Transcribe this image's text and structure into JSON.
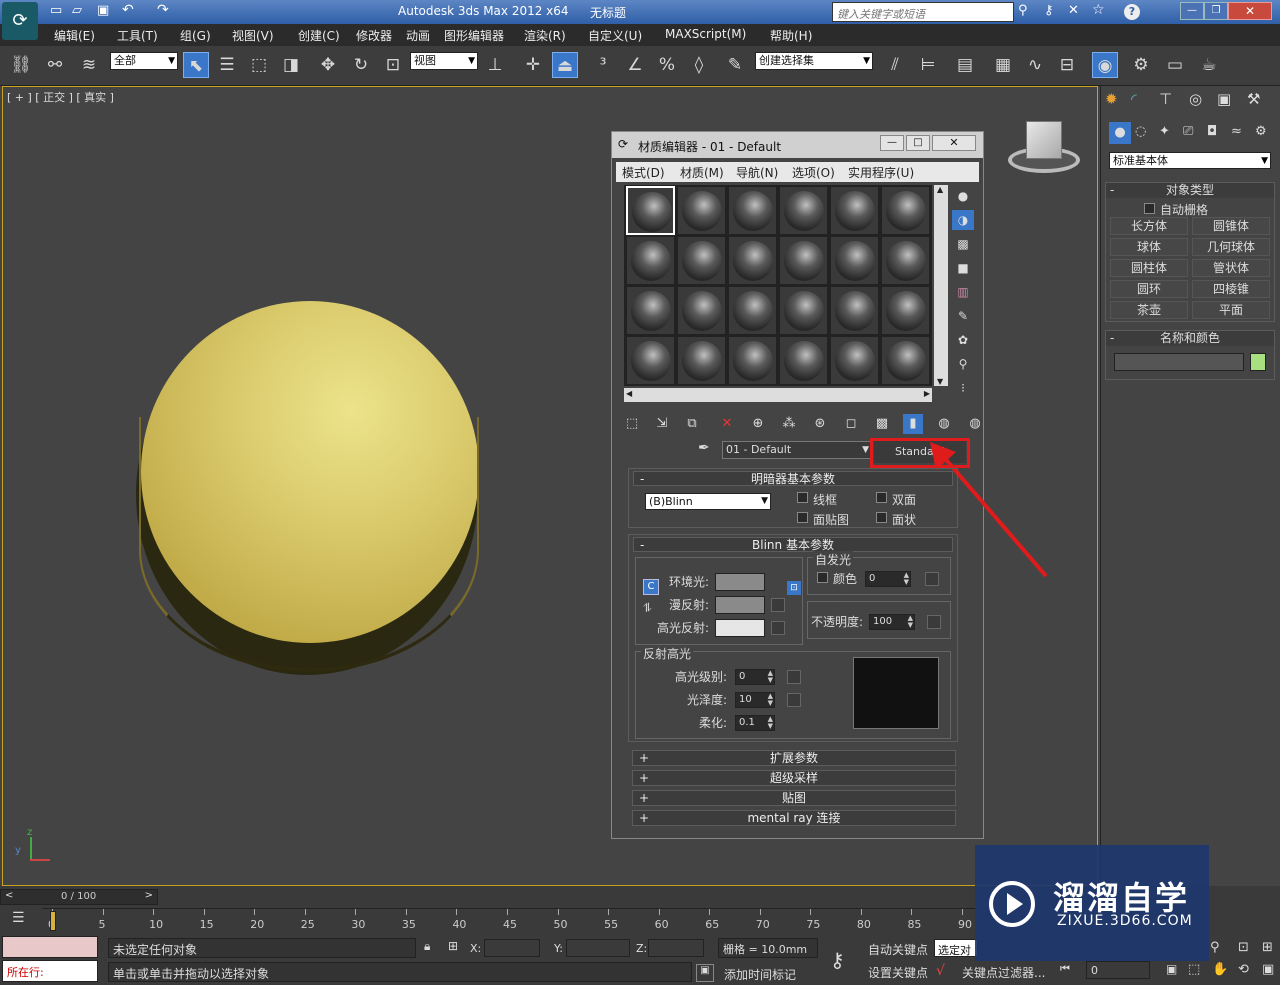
{
  "title_bar": {
    "app_title": "Autodesk 3ds Max  2012 x64",
    "doc_title": "无标题",
    "search_placeholder": "键入关键字或短语",
    "help": "?"
  },
  "menu": [
    "编辑(E)",
    "工具(T)",
    "组(G)",
    "视图(V)",
    "创建(C)",
    "修改器",
    "动画",
    "图形编辑器",
    "渲染(R)",
    "自定义(U)",
    "MAXScript(M)",
    "帮助(H)"
  ],
  "toolbar": {
    "selection_filter": "全部",
    "ref_coord": "视图",
    "named_selection": "创建选择集"
  },
  "viewport": {
    "label": "[ + ] [ 正交 ] [ 真实 ]"
  },
  "material_editor": {
    "title": "材质编辑器 - 01 - Default",
    "menus": [
      "模式(D)",
      "材质(M)",
      "导航(N)",
      "选项(O)",
      "实用程序(U)"
    ],
    "material_name": "01 - Default",
    "material_type": "Standard",
    "shader_rollout": {
      "title": "明暗器基本参数",
      "shader": "(B)Blinn",
      "wire": "线框",
      "two_sided": "双面",
      "face_map": "面贴图",
      "faceted": "面状"
    },
    "blinn_rollout": {
      "title": "Blinn 基本参数",
      "self_illum": "自发光",
      "color_label": "颜色",
      "color_value": "0",
      "ambient": "环境光:",
      "diffuse": "漫反射:",
      "specular": "高光反射:",
      "opacity_label": "不透明度:",
      "opacity_value": "100",
      "lock": "C"
    },
    "specular_highlights": {
      "title": "反射高光",
      "level_label": "高光级别:",
      "level_value": "0",
      "gloss_label": "光泽度:",
      "gloss_value": "10",
      "soften_label": "柔化:",
      "soften_value": "0.1"
    },
    "collapsed_rollouts": [
      "扩展参数",
      "超级采样",
      "贴图",
      "mental ray 连接"
    ],
    "colors": {
      "ambient": "#8a8a8a",
      "diffuse": "#8a8a8a",
      "specular": "#e6e6e6"
    }
  },
  "command_panel": {
    "category": "标准基本体",
    "rollout_object_type": "对象类型",
    "autogrid": "自动栅格",
    "objects": [
      "长方体",
      "圆锥体",
      "球体",
      "几何球体",
      "圆柱体",
      "管状体",
      "圆环",
      "四棱锥",
      "茶壶",
      "平面"
    ],
    "rollout_name_color": "名称和颜色",
    "object_color": "#a8e080"
  },
  "timeline": {
    "frame_counter": "0 / 100",
    "ticks": [
      "0",
      "5",
      "10",
      "15",
      "20",
      "25",
      "30",
      "35",
      "40",
      "45",
      "50",
      "55",
      "60",
      "65",
      "70",
      "75",
      "80",
      "85",
      "90"
    ]
  },
  "status": {
    "selection": "未选定任何对象",
    "prompt": "单击或单击并拖动以选择对象",
    "running": "所在行:",
    "x_label": "X:",
    "y_label": "Y:",
    "z_label": "Z:",
    "grid": "栅格 = 10.0mm",
    "auto_key": "自动关键点",
    "set_key": "设置关键点",
    "key_filter": "关键点过滤器...",
    "selected": "选定对",
    "add_time_tag": "添加时间标记",
    "frame": "0"
  },
  "watermark": {
    "brand": "溜溜自学",
    "url": "ZIXUE.3D66.COM"
  }
}
